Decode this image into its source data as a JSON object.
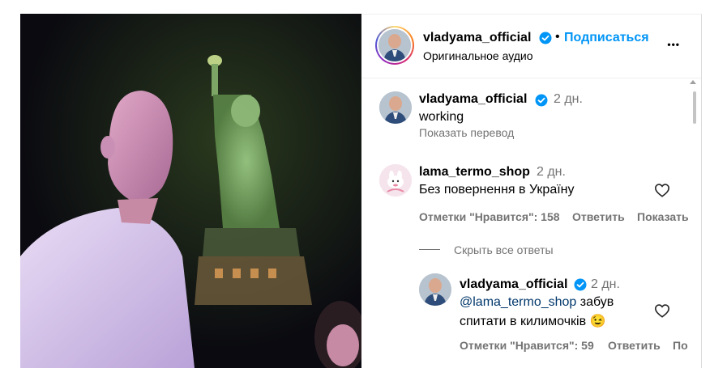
{
  "post_header": {
    "username": "vladyama_official",
    "separator": "•",
    "follow_label": "Подписаться",
    "audio_label": "Оригинальное аудио",
    "more_label": "•••"
  },
  "comments": [
    {
      "username": "vladyama_official",
      "time": "2 дн.",
      "text": "working",
      "translate_label": "Показать перевод"
    },
    {
      "username": "lama_termo_shop",
      "time": "2 дн.",
      "text": "Без повернення в Україну",
      "likes_label": "Отметки \"Нравится\": 158",
      "reply_label": "Ответить",
      "show_label": "Показать",
      "hide_replies_label": "Скрыть все ответы"
    }
  ],
  "reply": {
    "username": "vladyama_official",
    "time": "2 дн.",
    "mention": "@lama_termo_shop",
    "text_line1": " забув",
    "text_line2": "спитати в килимочків",
    "emoji": "😉",
    "likes_label": "Отметки \"Нравится\": 59",
    "reply_label": "Ответить",
    "more_label": "По"
  },
  "colors": {
    "link_blue": "#0095f6",
    "mention_blue": "#00376b",
    "muted": "#737373",
    "verified": "#0095f6"
  }
}
